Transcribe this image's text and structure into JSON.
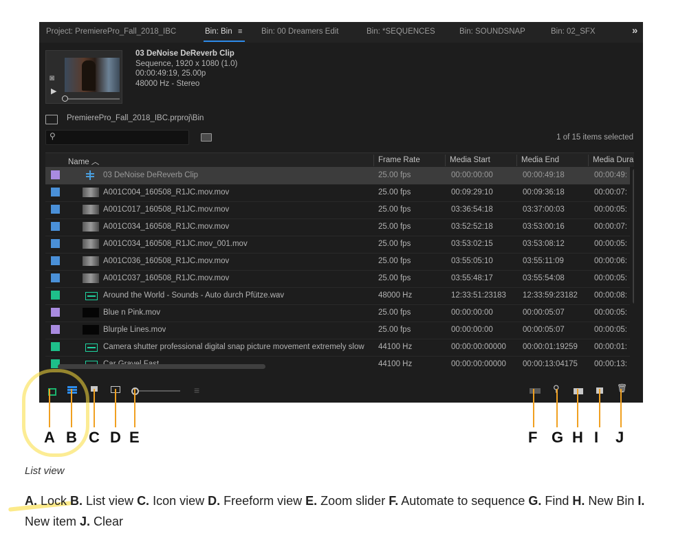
{
  "tabs": [
    {
      "label": "Project: PremierePro_Fall_2018_IBC",
      "active": false
    },
    {
      "label": "Bin: Bin",
      "active": true
    },
    {
      "label": "Bin: 00 Dreamers Edit",
      "active": false
    },
    {
      "label": "Bin: *SEQUENCES",
      "active": false
    },
    {
      "label": "Bin: SOUNDSNAP",
      "active": false
    },
    {
      "label": "Bin: 02_SFX",
      "active": false
    }
  ],
  "tab_menu_glyph": "≡",
  "tab_overflow_glyph": "»",
  "preview": {
    "title": "03 DeNoise DeReverb Clip",
    "line1": "Sequence, 1920 x 1080 (1.0)",
    "line2": "00:00:49:19, 25.00p",
    "line3": "48000 Hz - Stereo"
  },
  "path": "PremierePro_Fall_2018_IBC.prproj\\Bin",
  "search": {
    "glyph": "⚲",
    "value": ""
  },
  "item_count": "1 of 15 items selected",
  "columns": [
    {
      "label": "Name ︿"
    },
    {
      "label": "Frame Rate"
    },
    {
      "label": "Media Start"
    },
    {
      "label": "Media End"
    },
    {
      "label": "Media Dura"
    }
  ],
  "rows": [
    {
      "name": "03 DeNoise DeReverb Clip",
      "fps": "25.00 fps",
      "start": "00:00:00:00",
      "end": "00:00:49:18",
      "dur": "00:00:49:",
      "color": "#a98be0",
      "kind": "seq",
      "selected": true
    },
    {
      "name": "A001C004_160508_R1JC.mov.mov",
      "fps": "25.00 fps",
      "start": "00:09:29:10",
      "end": "00:09:36:18",
      "dur": "00:00:07:",
      "color": "#4a90d8",
      "kind": "video"
    },
    {
      "name": "A001C017_160508_R1JC.mov.mov",
      "fps": "25.00 fps",
      "start": "03:36:54:18",
      "end": "03:37:00:03",
      "dur": "00:00:05:",
      "color": "#4a90d8",
      "kind": "video"
    },
    {
      "name": "A001C034_160508_R1JC.mov.mov",
      "fps": "25.00 fps",
      "start": "03:52:52:18",
      "end": "03:53:00:16",
      "dur": "00:00:07:",
      "color": "#4a90d8",
      "kind": "video"
    },
    {
      "name": "A001C034_160508_R1JC.mov_001.mov",
      "fps": "25.00 fps",
      "start": "03:53:02:15",
      "end": "03:53:08:12",
      "dur": "00:00:05:",
      "color": "#4a90d8",
      "kind": "video"
    },
    {
      "name": "A001C036_160508_R1JC.mov.mov",
      "fps": "25.00 fps",
      "start": "03:55:05:10",
      "end": "03:55:11:09",
      "dur": "00:00:06:",
      "color": "#4a90d8",
      "kind": "video"
    },
    {
      "name": "A001C037_160508_R1JC.mov.mov",
      "fps": "25.00 fps",
      "start": "03:55:48:17",
      "end": "03:55:54:08",
      "dur": "00:00:05:",
      "color": "#4a90d8",
      "kind": "video"
    },
    {
      "name": "Around the World - Sounds - Auto durch Pfütze.wav",
      "fps": "48000 Hz",
      "start": "12:33:51:23183",
      "end": "12:33:59:23182",
      "dur": "00:00:08:",
      "color": "#1ec08a",
      "kind": "audio"
    },
    {
      "name": "Blue n Pink.mov",
      "fps": "25.00 fps",
      "start": "00:00:00:00",
      "end": "00:00:05:07",
      "dur": "00:00:05:",
      "color": "#a98be0",
      "kind": "black"
    },
    {
      "name": "Blurple Lines.mov",
      "fps": "25.00 fps",
      "start": "00:00:00:00",
      "end": "00:00:05:07",
      "dur": "00:00:05:",
      "color": "#a98be0",
      "kind": "black"
    },
    {
      "name": "Camera shutter professional digital snap picture movement extremely slow",
      "fps": "44100 Hz",
      "start": "00:00:00:00000",
      "end": "00:00:01:19259",
      "dur": "00:00:01:",
      "color": "#1ec08a",
      "kind": "audio"
    },
    {
      "name": "Car Gravel Fast",
      "fps": "44100 Hz",
      "start": "00:00:00:00000",
      "end": "00:00:13:04175",
      "dur": "00:00:13:",
      "color": "#1ec08a",
      "kind": "audio"
    }
  ],
  "footer_icons": {
    "lock": "lock-icon",
    "list_view": "list-view-icon",
    "icon_view": "icon-view-icon",
    "freeform_view": "freeform-view-icon",
    "zoom": "zoom-slider",
    "sort": "≡",
    "find": "⚲",
    "clear": "🗑"
  },
  "callouts": [
    "A",
    "B",
    "C",
    "D",
    "E",
    "F",
    "G",
    "H",
    "I",
    "J"
  ],
  "caption": "List view",
  "legend": [
    {
      "key": "A.",
      "text": " Lock "
    },
    {
      "key": "B.",
      "text": " List view "
    },
    {
      "key": "C.",
      "text": " Icon view "
    },
    {
      "key": "D.",
      "text": " Freeform view "
    },
    {
      "key": "E.",
      "text": " Zoom slider "
    },
    {
      "key": "F.",
      "text": " Automate to sequence "
    },
    {
      "key": "G.",
      "text": " Find "
    },
    {
      "key": "H.",
      "text": " New Bin "
    },
    {
      "key": "I.",
      "text": " New item "
    },
    {
      "key": "J.",
      "text": " Clear"
    }
  ],
  "colors": {
    "accent": "#2d8ceb",
    "callout": "#f0a020",
    "highlight": "#fadc3c"
  }
}
